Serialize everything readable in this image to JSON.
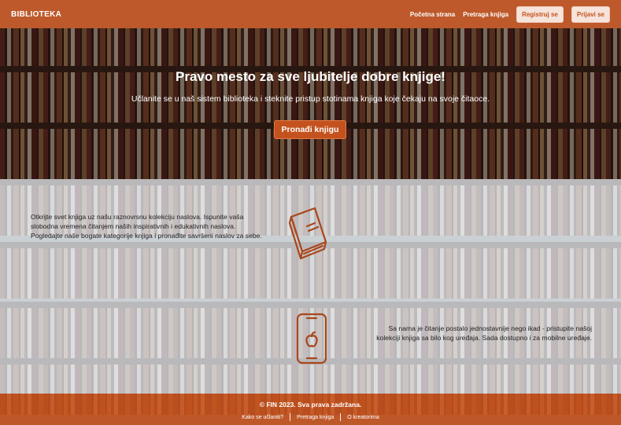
{
  "navbar": {
    "brand": "BIBLIOTEKA",
    "links": [
      "Početna strana",
      "Pretraga knjiga"
    ],
    "register_label": "Registruj se",
    "login_label": "Prijavi se"
  },
  "hero": {
    "title": "Pravo mesto za sve ljubitelje dobre knjige!",
    "subtitle": "Učlanite se u naš sistem biblioteka i steknite pristup stotinama knjiga koje čekaju na svoje čitaoce.",
    "button_label": "Pronađi knjigu"
  },
  "features": [
    {
      "text": "Otkrijte svet knjiga uz našu raznovrsnu kolekciju naslova. Ispunite vaša slobodna vremena čitanjem naših inspirativnih i edukativnih naslova. Pogledajte naše bogate kategorije knjiga i pronađite savršeni naslov za sebe.",
      "icon": "book-icon"
    },
    {
      "text": "Sa nama je čitanje postalo jednostavnije nego ikad - pristupite našoj kolekciji knjiga sa bilo kog uređaja. Sada dostupno i za mobilne uređaje.",
      "icon": "phone-icon"
    }
  ],
  "footer": {
    "copyright": "© FIN 2023. Sva prava zadržana.",
    "links": [
      "Kako se učlaniti?",
      "Pretraga knjiga",
      "O kreatorima"
    ]
  },
  "colors": {
    "accent": "#c4521e",
    "light_button": "#f6e3da"
  }
}
